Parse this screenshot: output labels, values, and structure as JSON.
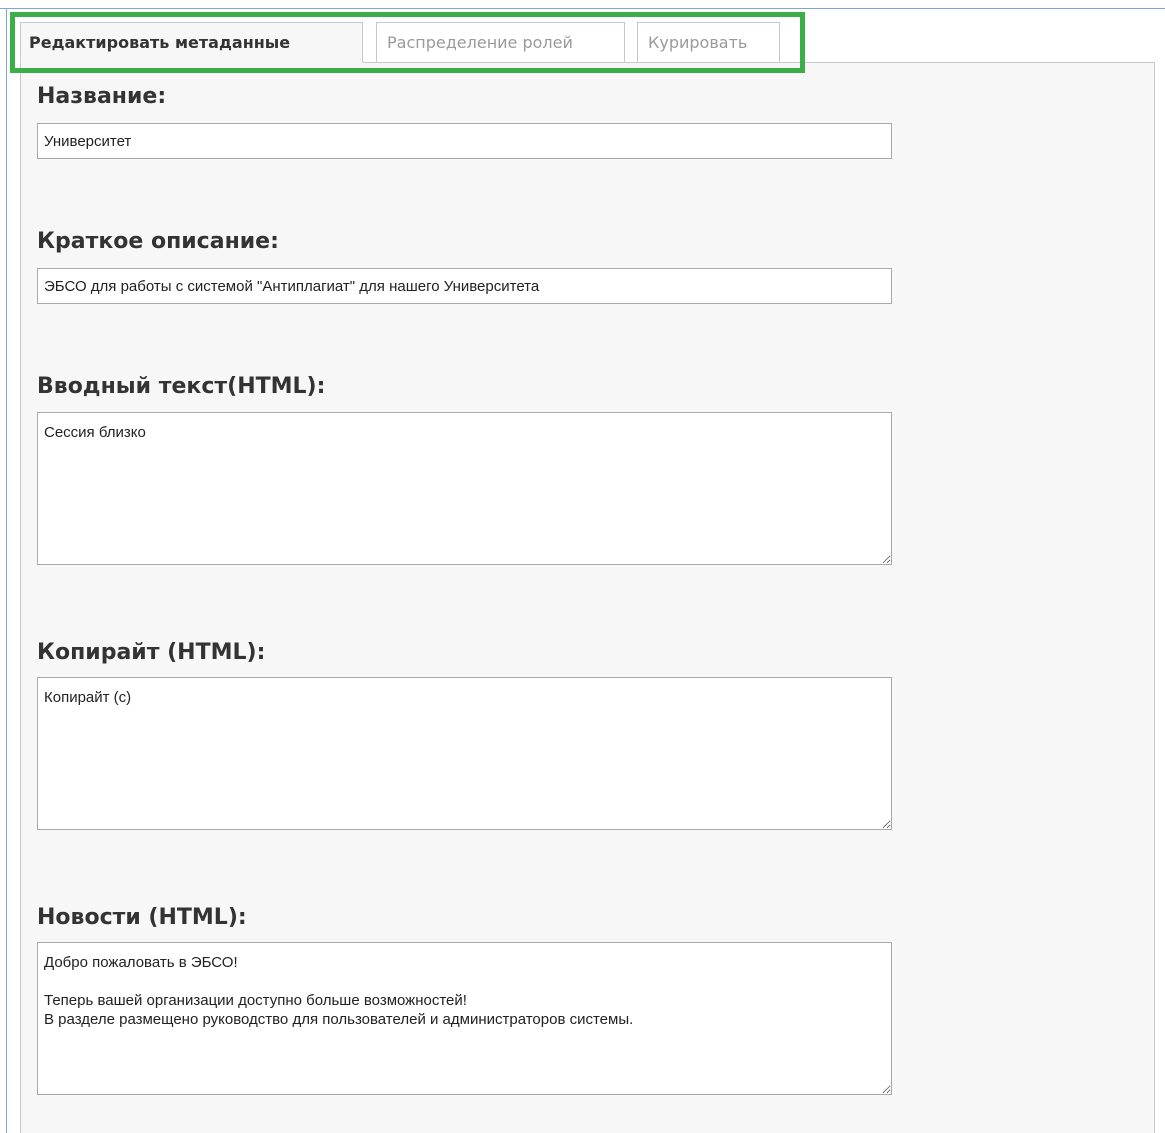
{
  "tabs": [
    {
      "label": "Редактировать метаданные",
      "active": true
    },
    {
      "label": "Распределение ролей",
      "active": false
    },
    {
      "label": "Курировать",
      "active": false
    }
  ],
  "form": {
    "name": {
      "label": "Название:",
      "value": "Университет"
    },
    "short_description": {
      "label": "Краткое описание:",
      "value": "ЭБСО для работы с системой \"Антиплагиат\" для нашего Университета"
    },
    "intro_text": {
      "label": "Вводный текст(HTML):",
      "value": "Сессия близко"
    },
    "copyright": {
      "label": "Копирайт (HTML):",
      "value": "Копирайт (c)"
    },
    "news": {
      "label": "Новости (HTML):",
      "value": "Добро пожаловать в ЭБСО!\n\nТеперь вашей организации доступно больше возможностей!\nВ разделе размещено руководство для пользователей и администраторов системы."
    }
  },
  "colors": {
    "highlight": "#3cae48",
    "window_edge": "#7ea6d8",
    "panel_bg": "#f7f7f7"
  }
}
